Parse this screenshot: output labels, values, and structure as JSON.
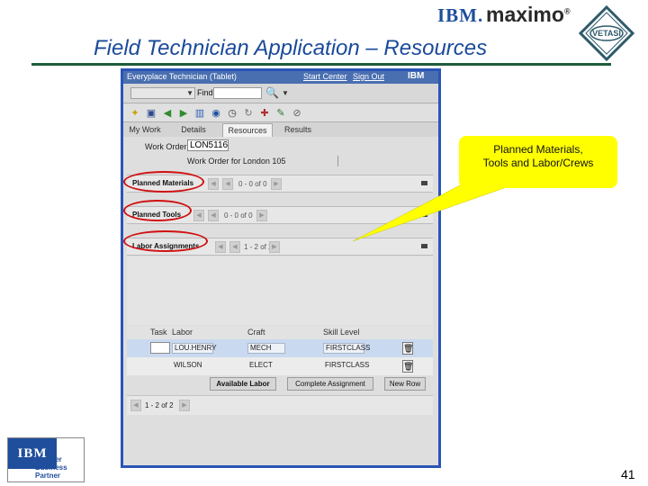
{
  "slide": {
    "title": "Field Technician Application – Resources",
    "page_number": "41",
    "ibm_logo": "IBM.",
    "maximo_logo": "maximo",
    "vetasi_logo": "VETASI"
  },
  "app": {
    "window_title": "Everyplace Technician (Tablet)",
    "start_center": "Start Center",
    "sign_out": "Sign Out",
    "brand": "IBM",
    "find_label": "Find:",
    "tabs": [
      {
        "label": "My Work",
        "active": false
      },
      {
        "label": "Details",
        "active": false
      },
      {
        "label": "Resources",
        "active": true
      },
      {
        "label": "Results",
        "active": false
      }
    ],
    "work_order_label": "Work Order",
    "work_order_value": "LON5116",
    "work_order_description": "Work Order for London 105",
    "sections": {
      "materials": {
        "title": "Planned Materials",
        "pager": "0 - 0 of 0"
      },
      "tools": {
        "title": "Planned Tools",
        "pager": "0 - 0 of 0"
      },
      "labor": {
        "title": "Labor Assignments",
        "pager": "1 - 2 of 2"
      }
    },
    "grid": {
      "columns": [
        "Task",
        "Labor",
        "Craft",
        "Skill Level"
      ],
      "rows": [
        {
          "labor": "LOU.HENRY",
          "craft": "MECH",
          "skill": "FIRSTCLASS"
        },
        {
          "labor": "WILSON",
          "craft": "ELECT",
          "skill": "FIRSTCLASS"
        }
      ]
    },
    "buttons": {
      "available_labor": "Available Labor",
      "complete_assignment": "Complete Assignment",
      "new_row": "New Row"
    },
    "bottom_pager": "1 - 2 of 2"
  },
  "callout": {
    "line1": "Planned Materials,",
    "line2": "Tools and Labor/Crews",
    "color": "#ffff00"
  },
  "partner_badge": {
    "ibm": "IBM",
    "line1": "Premier",
    "line2": "Business",
    "line3": "Partner"
  },
  "colors": {
    "title": "#1a4a9a",
    "rule": "#1d5c3c",
    "frame": "#2b54b8",
    "highlight_oval": "#d01010"
  }
}
